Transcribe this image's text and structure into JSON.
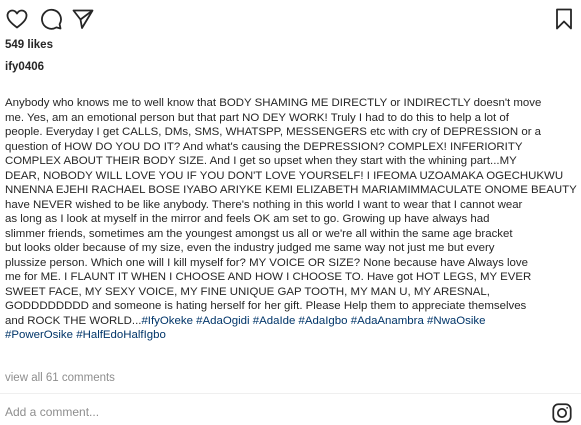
{
  "post": {
    "likes": "549 likes",
    "username": "ify0406",
    "caption_lines": [
      "Anybody who knows me to well know that BODY SHAMING ME DIRECTLY or INDIRECTLY doesn't move",
      "me. Yes, am an emotional person but that part NO DEY WORK! Truly I had to do this to help a lot of",
      "people. Everyday I get CALLS, DMs, SMS, WHATSPP, MESSENGERS etc with cry of DEPRESSION or a",
      "question of HOW DO YOU DO IT? And what's causing the DEPRESSION? COMPLEX! INFERIORITY",
      "COMPLEX ABOUT THEIR BODY SIZE. And I get so upset when they start with the whining part...MY",
      "DEAR, NOBODY WILL LOVE YOU IF YOU DON'T LOVE YOURSELF! I IFEOMA UZOAMAKA OGECHUKWU",
      "NNENNA EJEHI RACHAEL BOSE IYABO ARIYKE KEMI ELIZABETH MARIAMIMMACULATE ONOME BEAUTY",
      "have NEVER wished to be like anybody. There's nothing in this world I want to wear that I cannot wear",
      "as long as I look at myself in the mirror and feels OK am set to go. Growing up have always had",
      "slimmer friends, sometimes am the youngest amongst us all or we're all within the same age bracket",
      "but looks older because of my size, even the industry judged me same way not just me but every",
      "plussize person. Which one will I kill myself for? MY VOICE OR SIZE? None because have Always love",
      "me for ME. I FLAUNT IT WHEN I CHOOSE AND HOW I CHOOSE TO. Have got HOT LEGS, MY EVER",
      "SWEET FACE, MY SEXY VOICE, MY FINE UNIQUE GAP TOOTH, MY MAN U, MY ARESNAL,",
      "GODDDDDDDD and someone is hating herself for her gift. Please Help them to appreciate themselves"
    ],
    "caption_last_text": "and ROCK THE WORLD...",
    "hashtags_line1": [
      "#IfyOkeke",
      "#AdaOgidi",
      "#AdaIde",
      "#AdaIgbo",
      "#AdaAnambra",
      "#NwaOsike"
    ],
    "hashtags_line2": [
      "#PowerOsike",
      "#HalfEdoHalfIgbo"
    ],
    "view_comments": "view all 61 comments",
    "comment_placeholder": "Add a comment..."
  },
  "icons": {
    "like": "heart-icon",
    "comment": "comment-icon",
    "share": "share-icon",
    "save": "bookmark-icon",
    "more": "instagram-icon"
  }
}
